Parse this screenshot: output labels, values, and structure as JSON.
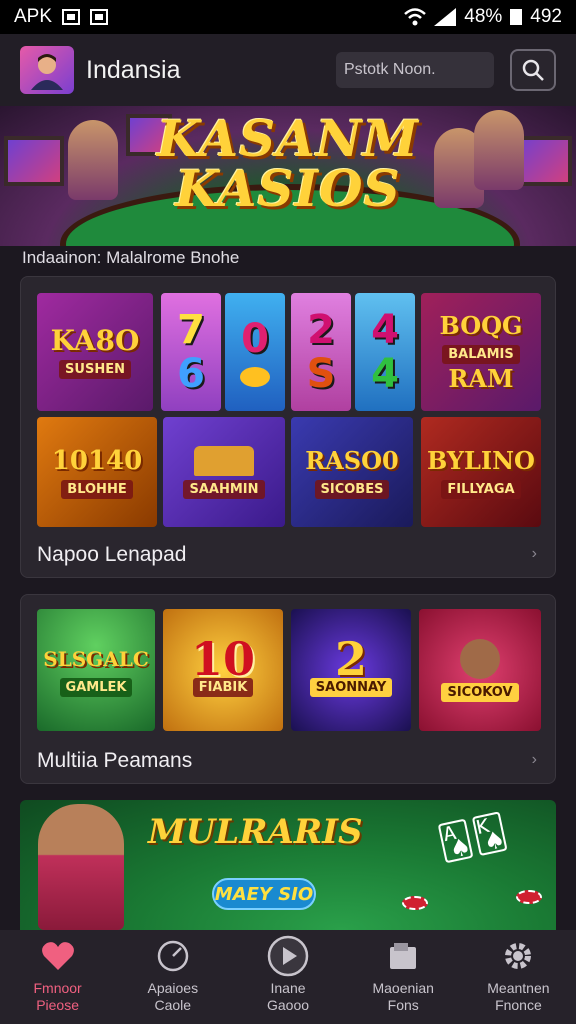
{
  "status_bar": {
    "carrier": "APK",
    "battery": "48%",
    "time": "492"
  },
  "header": {
    "title": "Indansia",
    "search_placeholder": "Pstotk Noon."
  },
  "hero": {
    "title_line1": "KASANM",
    "title_line2": "KASIOS"
  },
  "section_subtitle": "Indaainon: Malalrome Bnohe",
  "panel1": {
    "label": "Napoo Lenapad",
    "row1": [
      {
        "big": "KA8O",
        "small": "SUSHEN"
      },
      {
        "slots": [
          "7",
          "6"
        ]
      },
      {
        "slots": [
          "0",
          ""
        ]
      },
      {
        "slots": [
          "2",
          "S"
        ]
      },
      {
        "slots": [
          "4",
          "4"
        ]
      },
      {
        "big": "BOQG",
        "small": "BALAMIS",
        "big2": "RAM"
      }
    ],
    "row2": [
      {
        "big": "10140",
        "small": "BLOHHE"
      },
      {
        "big": "",
        "small": "SAAHMIN"
      },
      {
        "big": "RASO0",
        "small": "SICOBES"
      },
      {
        "big": "BYLINO",
        "small": "FILLYAGA"
      }
    ]
  },
  "panel2": {
    "label": "Multiia Peamans",
    "tiles": [
      {
        "big": "SLSGALC",
        "small": "GAMLEK"
      },
      {
        "big": "10",
        "small": "FIABIK"
      },
      {
        "big": "2",
        "small": "SAONNAY"
      },
      {
        "big": "",
        "small": "SICOKOV"
      }
    ]
  },
  "promo": {
    "title": "MULRARIS",
    "button": "MAEY SIO"
  },
  "bottom_nav": [
    {
      "line1": "Fmnoor",
      "line2": "Pieose",
      "icon": "heart-icon"
    },
    {
      "line1": "Apaioes",
      "line2": "Caole",
      "icon": "gauge-icon"
    },
    {
      "line1": "Inane",
      "line2": "Gaooo",
      "icon": "play-icon"
    },
    {
      "line1": "Maoenian",
      "line2": "Fons",
      "icon": "folder-icon"
    },
    {
      "line1": "Meantnen",
      "line2": "Fnonce",
      "icon": "gear-icon"
    }
  ],
  "colors": {
    "accent": "#f06080",
    "gold": "#ffd23a",
    "background": "#1c1820"
  }
}
